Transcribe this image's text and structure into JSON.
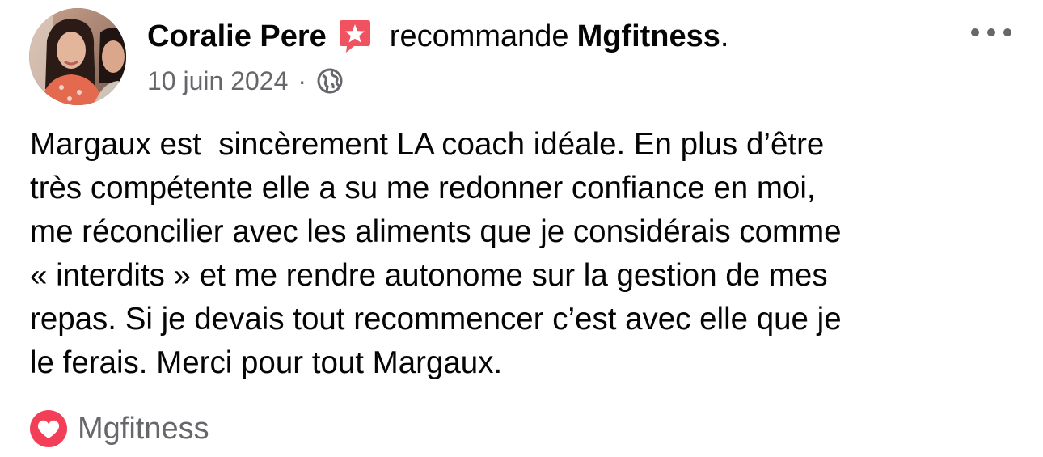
{
  "post": {
    "author": "Coralie Pere",
    "verb": "recommande",
    "page_name": "Mgfitness",
    "period": ".",
    "date": "10 juin 2024",
    "separator": "·",
    "audience_icon": "globe-icon",
    "badge_icon": "recommendation-star-icon",
    "more_icon": "more-options-icon",
    "body_lines": [
      "Margaux est  sincèrement LA coach idéale. En plus d’être",
      "très compétente elle a su me redonner confiance en moi,",
      "me réconcilier avec les aliments que je considérais comme",
      "« interdits » et me rendre autonome sur la gestion de mes",
      "repas. Si je devais tout recommencer c’est avec elle que je",
      "le ferais. Merci pour tout Margaux."
    ],
    "reaction": {
      "icon": "heart-icon",
      "label": "Mgfitness"
    }
  },
  "colors": {
    "text_primary": "#050505",
    "text_secondary": "#65676b",
    "badge_red": "#f0525f",
    "heart_red": "#f33e58"
  }
}
